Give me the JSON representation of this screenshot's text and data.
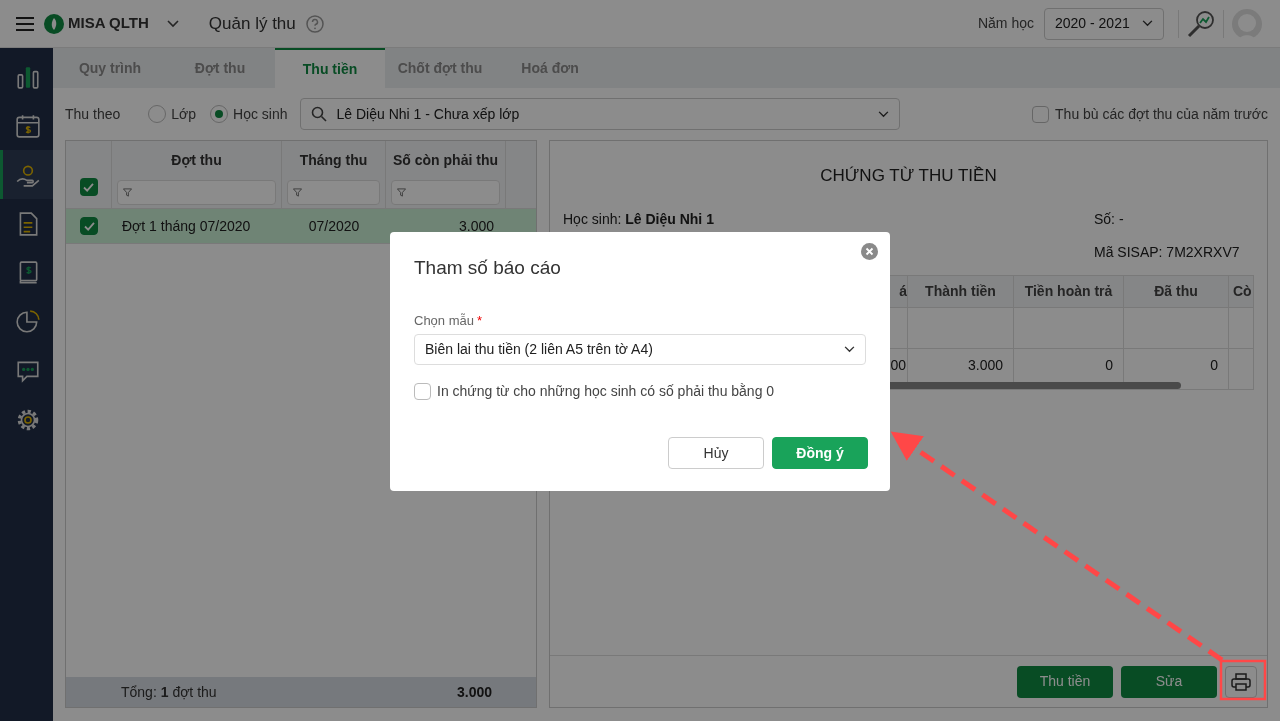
{
  "app": {
    "name": "MISA QLTH",
    "page_title": "Quản lý thu"
  },
  "header": {
    "year_label": "Năm học",
    "year_value": "2020 - 2021"
  },
  "sidebar": {
    "items": [
      {
        "kind": "chart",
        "selected": false
      },
      {
        "kind": "calendar",
        "selected": false
      },
      {
        "kind": "hand",
        "selected": true
      },
      {
        "kind": "document",
        "selected": false
      },
      {
        "kind": "book",
        "selected": false
      },
      {
        "kind": "pie",
        "selected": false
      },
      {
        "kind": "chat",
        "selected": false
      },
      {
        "kind": "gear",
        "selected": false
      }
    ]
  },
  "tabs": [
    {
      "label": "Quy trình",
      "selected": false
    },
    {
      "label": "Đợt thu",
      "selected": false
    },
    {
      "label": "Thu tiền",
      "selected": true
    },
    {
      "label": "Chốt đợt thu",
      "selected": false
    },
    {
      "label": "Hoá đơn",
      "selected": false
    }
  ],
  "filter": {
    "label": "Thu theo",
    "options": [
      {
        "label": "Lớp",
        "selected": false
      },
      {
        "label": "Học sinh",
        "selected": true
      }
    ],
    "search_value": "Lê Diệu Nhi 1 - Chưa xếp lớp",
    "carry_over": {
      "label": "Thu bù các đợt thu của năm trước",
      "checked": false
    }
  },
  "batches_table": {
    "columns": [
      "Đợt thu",
      "Tháng thu",
      "Số còn phải thu"
    ],
    "all_checked": true,
    "rows": [
      {
        "checked": true,
        "selected": true,
        "cells": [
          "Đợt 1 tháng 07/2020",
          "07/2020",
          "3.000"
        ]
      }
    ],
    "footer": {
      "label": "Tổng: **1** đợt thu",
      "total": "3.000"
    }
  },
  "voucher": {
    "title": "CHỨNG TỪ THU TIỀN",
    "student": "Học sinh: **Lê Diệu Nhi 1**",
    "number": "Số: -",
    "sisap": "Mã SISAP: 7M2XRXV7",
    "columns": [
      "á",
      "Thành tiền",
      "Tiền hoàn trả",
      "Đã thu",
      "Cò"
    ],
    "rows": [
      [
        "00",
        "3.000",
        "0",
        "0"
      ]
    ],
    "buttons": [
      "Thu tiền",
      "Sửa"
    ]
  },
  "dialog": {
    "title": "Tham số báo cáo",
    "field_label": "Chọn mẫu",
    "required_mark": "*",
    "template_value": "Biên lai thu tiền (2 liên A5 trên tờ A4)",
    "option": {
      "label": "In chứng từ cho những học sinh có số phải thu bằng 0",
      "checked": false
    },
    "buttons": [
      {
        "label": "Hủy",
        "kind": "secondary"
      },
      {
        "label": "Đồng ý",
        "kind": "primary"
      }
    ]
  }
}
